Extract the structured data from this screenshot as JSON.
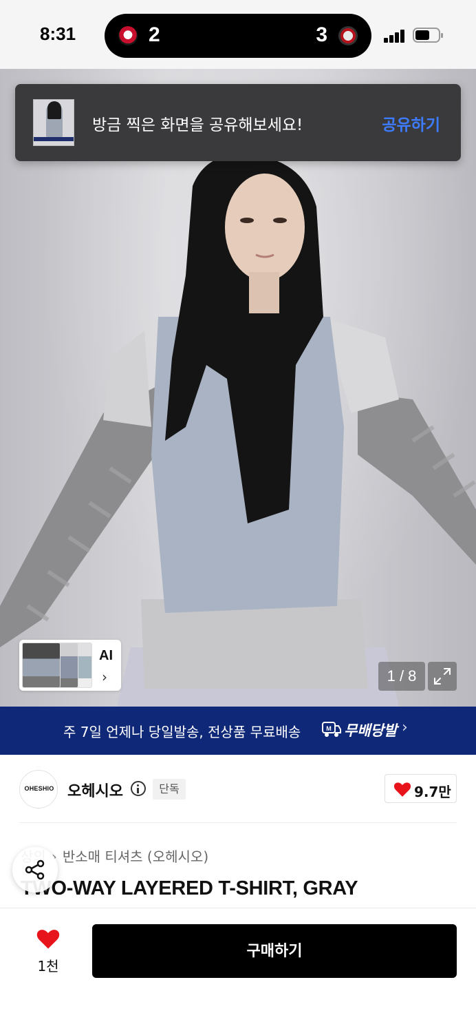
{
  "status_bar": {
    "time": "8:31",
    "live_activity": {
      "home_score": "2",
      "away_score": "3",
      "home_team_icon": "lg-twins-logo",
      "away_team_icon": "kt-wiz-logo"
    },
    "signal_icon": "cellular-signal-icon",
    "battery_icon": "battery-icon",
    "battery_level": 0.5
  },
  "toast": {
    "message": "방금 찍은 화면을 공유해보세요!",
    "action_label": "공유하기",
    "action_color": "#3d7bff",
    "thumbnail_icon": "screenshot-thumbnail"
  },
  "gallery": {
    "ai_label": "AI",
    "counter": "1 / 8",
    "expand_icon": "expand-icon"
  },
  "delivery_banner": {
    "text": "주 7일 언제나 당일발송, 전상품 무료배송",
    "badge_label": "무배당발",
    "badge_icon": "delivery-truck-icon",
    "background": "#0f2878"
  },
  "brand": {
    "logo_text": "OHESHIO",
    "name": "오헤시오",
    "exclusive_label": "단독",
    "likes": "9.7만"
  },
  "breadcrumb": {
    "category": "상의",
    "subcategory": "반소매 티셔츠 (오헤시오)"
  },
  "product": {
    "title": "TWO-WAY LAYERED T-SHIRT, GRAY"
  },
  "bottom_bar": {
    "wishlist_count": "1천",
    "buy_label": "구매하기",
    "heart_color": "#e8141b"
  }
}
